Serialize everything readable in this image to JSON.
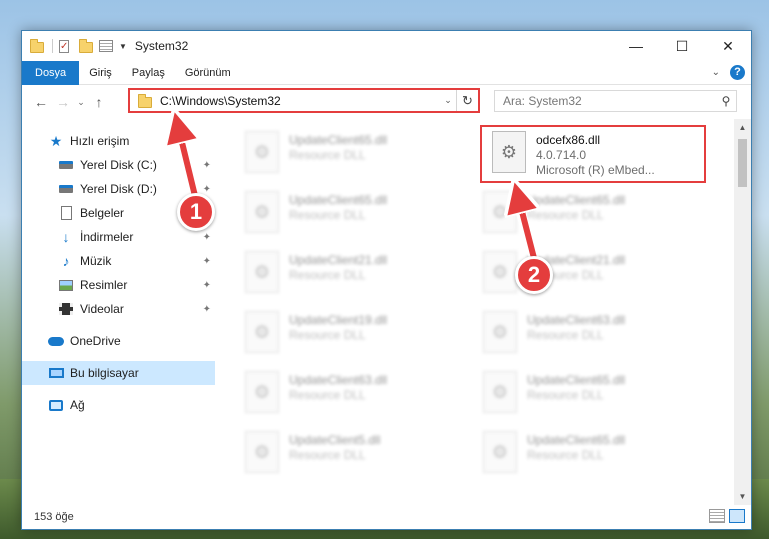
{
  "window": {
    "title": "System32",
    "controls": {
      "minimize": "—",
      "maximize": "☐",
      "close": "✕"
    }
  },
  "ribbon": {
    "tabs": [
      "Dosya",
      "Giriş",
      "Paylaş",
      "Görünüm"
    ],
    "help": "?",
    "collapse": "⌄"
  },
  "address": {
    "path": "C:\\Windows\\System32",
    "back": "←",
    "forward": "→",
    "recent": "⌄",
    "up": "↑",
    "dropdown": "⌄",
    "refresh": "↻"
  },
  "search": {
    "placeholder": "Ara: System32",
    "icon": "⚲"
  },
  "sidebar": {
    "items": [
      {
        "label": "Hızlı erişim",
        "icon": "star-icon",
        "pinned": false
      },
      {
        "label": "Yerel Disk (C:)",
        "icon": "drive-icon",
        "pinned": true
      },
      {
        "label": "Yerel Disk (D:)",
        "icon": "drive-icon",
        "pinned": true
      },
      {
        "label": "Belgeler",
        "icon": "document-icon",
        "pinned": false
      },
      {
        "label": "İndirmeler",
        "icon": "download-icon",
        "pinned": true
      },
      {
        "label": "Müzik",
        "icon": "music-icon",
        "pinned": true
      },
      {
        "label": "Resimler",
        "icon": "pictures-icon",
        "pinned": true
      },
      {
        "label": "Videolar",
        "icon": "videos-icon",
        "pinned": true
      },
      {
        "label": "OneDrive",
        "icon": "cloud-icon",
        "pinned": false
      },
      {
        "label": "Bu bilgisayar",
        "icon": "computer-icon",
        "pinned": false,
        "selected": true
      },
      {
        "label": "Ağ",
        "icon": "network-icon",
        "pinned": false
      }
    ],
    "pin_glyph": "📌"
  },
  "files": {
    "left_column": [
      {
        "name": "UpdateClient65.dll",
        "type": "Resource DLL"
      },
      {
        "name": "UpdateClient65.dll",
        "type": "Resource DLL"
      },
      {
        "name": "UpdateClient21.dll",
        "type": "Resource DLL"
      },
      {
        "name": "UpdateClient19.dll",
        "type": "Resource DLL"
      },
      {
        "name": "UpdateClient63.dll",
        "type": "Resource DLL"
      },
      {
        "name": "UpdateClient5.dll",
        "type": "Resource DLL"
      }
    ],
    "right_column": [
      {
        "name": "odcefx86.dll",
        "version": "4.0.714.0",
        "desc": "Microsoft (R) eMbed...",
        "highlighted": true
      },
      {
        "name": "UpdateClient65.dll",
        "type": "Resource DLL"
      },
      {
        "name": "UpdateClient21.dll",
        "type": "Resource DLL"
      },
      {
        "name": "UpdateClient63.dll",
        "type": "Resource DLL"
      },
      {
        "name": "UpdateClient65.dll",
        "type": "Resource DLL"
      },
      {
        "name": "UpdateClient65.dll",
        "type": "Resource DLL"
      }
    ]
  },
  "status": {
    "count": "153 öğe"
  },
  "annotations": {
    "callout_1": "1",
    "callout_2": "2",
    "highlight_color": "#e43d3d"
  },
  "colors": {
    "accent": "#1979ca",
    "selection": "#cce8ff"
  }
}
